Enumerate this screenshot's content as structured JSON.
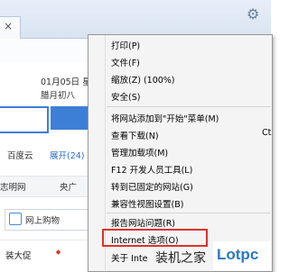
{
  "browser": {
    "tab_close": "×",
    "gear_icon": "gear-icon"
  },
  "page": {
    "date_line": "01月05日 星",
    "lunar_line": "腊月初八",
    "links_row": [
      "百度云",
      "展开(24)"
    ],
    "nav_row": [
      "志明网",
      "央广"
    ],
    "shop_label": "网上购物",
    "promo_text": "装大促",
    "colors": {
      "accent": "#3d7fd6",
      "link": "#2b6cc4"
    }
  },
  "menu": {
    "items": [
      "打印(P)",
      "文件(F)",
      "缩放(Z) (100%)",
      "安全(S)",
      "将网站添加到\"开始\"菜单(M)",
      "查看下载(N)",
      "管理加载项(M)",
      "F12 开发人员工具(L)",
      "转到已固定的网站(G)",
      "兼容性视图设置(B)",
      "报告网站问题(R)",
      "Internet 选项(O)",
      "关于 Inte"
    ],
    "shortcut_fragment": "Ct",
    "highlight_color": "#e0312c"
  },
  "watermark": {
    "text": "装机之家",
    "logo": "Lotpc"
  }
}
